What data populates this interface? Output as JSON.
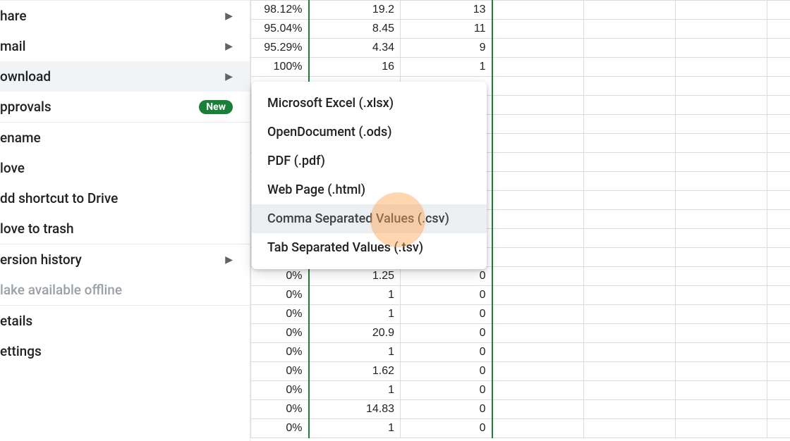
{
  "menu": {
    "share": "hare",
    "email": "mail",
    "download": "ownload",
    "approvals": "pprovals",
    "approvals_badge": "New",
    "rename": "ename",
    "move": "love",
    "addShortcut": "dd shortcut to Drive",
    "trash": "love to trash",
    "version": "ersion history",
    "offline": "lake available offline",
    "details": "etails",
    "settings": "ettings"
  },
  "submenu": {
    "xlsx": "Microsoft Excel (.xlsx)",
    "ods": "OpenDocument (.ods)",
    "pdf": "PDF (.pdf)",
    "html": "Web Page (.html)",
    "csv": "Comma Separated Values (.csv)",
    "tsv": "Tab Separated Values (.tsv)"
  },
  "rows": [
    {
      "c1": "98.12%",
      "c2": "19.2",
      "c3": "13"
    },
    {
      "c1": "95.04%",
      "c2": "8.45",
      "c3": "11"
    },
    {
      "c1": "95.29%",
      "c2": "4.34",
      "c3": "9"
    },
    {
      "c1": "100%",
      "c2": "16",
      "c3": "1"
    },
    {
      "c1": "",
      "c2": "",
      "c3": ""
    },
    {
      "c1": "",
      "c2": "",
      "c3": ""
    },
    {
      "c1": "",
      "c2": "",
      "c3": ""
    },
    {
      "c1": "",
      "c2": "",
      "c3": ""
    },
    {
      "c1": "",
      "c2": "",
      "c3": ""
    },
    {
      "c1": "",
      "c2": "",
      "c3": ""
    },
    {
      "c1": "",
      "c2": "",
      "c3": ""
    },
    {
      "c1": "",
      "c2": "",
      "c3": ""
    },
    {
      "c1": "",
      "c2": "",
      "c3": ""
    },
    {
      "c1": "",
      "c2": "",
      "c3": ""
    },
    {
      "c1": "0%",
      "c2": "1.25",
      "c3": "0"
    },
    {
      "c1": "0%",
      "c2": "1",
      "c3": "0"
    },
    {
      "c1": "0%",
      "c2": "1",
      "c3": "0"
    },
    {
      "c1": "0%",
      "c2": "20.9",
      "c3": "0"
    },
    {
      "c1": "0%",
      "c2": "1",
      "c3": "0"
    },
    {
      "c1": "0%",
      "c2": "1.62",
      "c3": "0"
    },
    {
      "c1": "0%",
      "c2": "1",
      "c3": "0"
    },
    {
      "c1": "0%",
      "c2": "14.83",
      "c3": "0"
    },
    {
      "c1": "0%",
      "c2": "1",
      "c3": "0"
    }
  ]
}
